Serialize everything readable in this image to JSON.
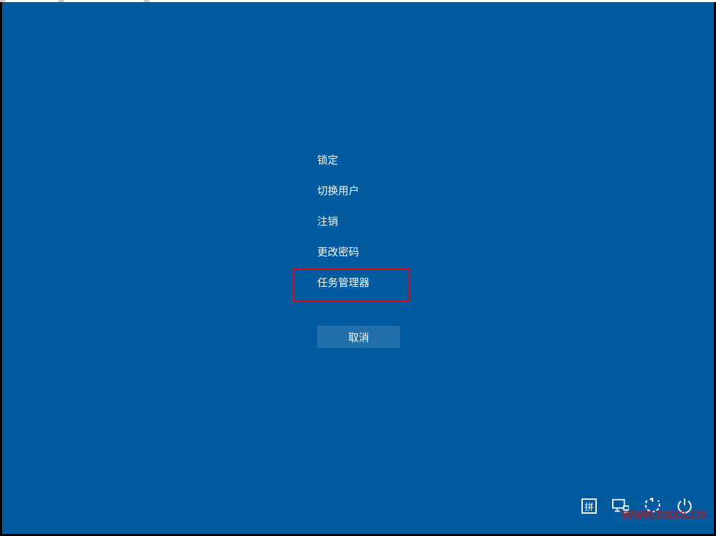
{
  "options": {
    "lock": "锁定",
    "switch_user": "切换用户",
    "sign_out": "注销",
    "change_password": "更改密码",
    "task_manager": "任务管理器"
  },
  "cancel_label": "取消",
  "ime_label": "拼",
  "watermark": "www.naxs.cn"
}
